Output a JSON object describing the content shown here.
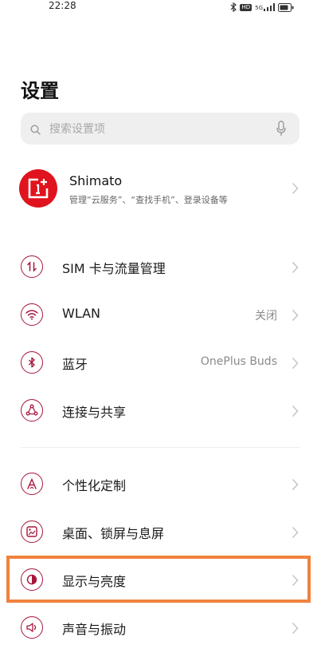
{
  "status_bar": {
    "time": "22:28",
    "icons": [
      "bluetooth-icon",
      "hd-icon",
      "signal-icon",
      "battery-icon"
    ],
    "hd_label": "HD",
    "signal_label": "5G"
  },
  "header": {
    "title": "设置"
  },
  "search": {
    "placeholder": "搜索设置项"
  },
  "account": {
    "name": "Shimato",
    "description": "管理“云服务”、“查找手机”、登录设备等",
    "avatar_color": "#e0141e"
  },
  "settings": [
    {
      "label": "SIM 卡与流量管理",
      "value": "",
      "icon": "sim-data-icon"
    },
    {
      "label": "WLAN",
      "value": "关闭",
      "icon": "wifi-icon"
    },
    {
      "label": "蓝牙",
      "value": "OnePlus Buds",
      "icon": "bluetooth-icon"
    },
    {
      "label": "连接与共享",
      "value": "",
      "icon": "connection-share-icon"
    },
    {
      "label": "个性化定制",
      "value": "",
      "icon": "personalization-icon"
    },
    {
      "label": "桌面、锁屏与息屏",
      "value": "",
      "icon": "wallpaper-icon"
    },
    {
      "label": "显示与亮度",
      "value": "",
      "icon": "display-brightness-icon",
      "highlighted": true
    },
    {
      "label": "声音与振动",
      "value": "",
      "icon": "sound-vibration-icon"
    }
  ],
  "colors": {
    "accent": "#a8163c",
    "highlight": "#f0823e",
    "search_bg": "#efefef"
  }
}
